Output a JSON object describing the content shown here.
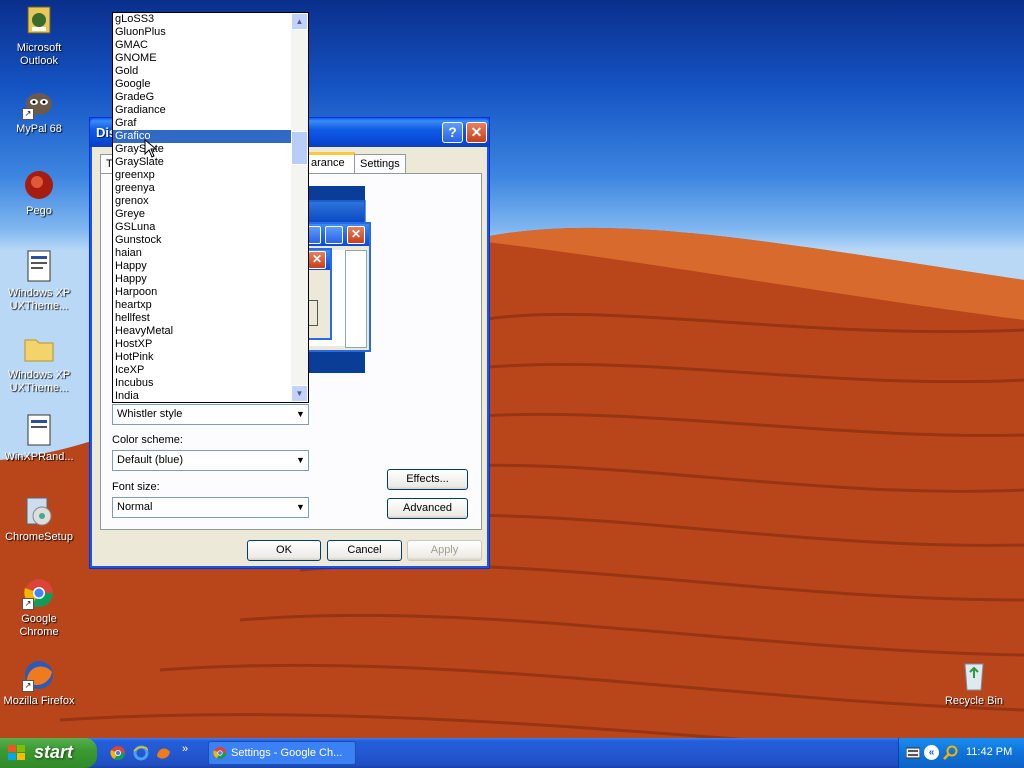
{
  "desktop": {
    "icons": [
      {
        "label": "Microsoft\nOutlook",
        "icon": "outlook-icon"
      },
      {
        "label": "MyPal 68",
        "icon": "mypal-icon"
      },
      {
        "label": "Pego",
        "icon": "pego-icon"
      },
      {
        "label": "Windows XP UXTheme...",
        "icon": "document-icon"
      },
      {
        "label": "Windows XP UXTheme...",
        "icon": "folder-icon"
      },
      {
        "label": "WinXPRand...",
        "icon": "document-icon"
      },
      {
        "label": "ChromeSetup",
        "icon": "installer-icon"
      },
      {
        "label": "Google Chrome",
        "icon": "chrome-icon"
      },
      {
        "label": "Mozilla Firefox",
        "icon": "firefox-icon"
      },
      {
        "label": "Recycle Bin",
        "icon": "recycle-bin-icon"
      }
    ]
  },
  "dialog": {
    "title": "Dis",
    "tabs": [
      "T",
      "arance",
      "Settings"
    ],
    "help_btn": "?",
    "close_btn": "✕",
    "windows_buttons_value": "Whistler style",
    "color_scheme_label": "Color scheme:",
    "color_scheme_value": "Default (blue)",
    "font_size_label": "Font size:",
    "font_size_value": "Normal",
    "effects_btn": "Effects...",
    "advanced_btn": "Advanced",
    "ok_btn": "OK",
    "cancel_btn": "Cancel",
    "apply_btn": "Apply"
  },
  "dropdown": {
    "selected": "Grafico",
    "items": [
      "gLoSS3",
      "GluonPlus",
      "GMAC",
      "GNOME",
      "Gold",
      "Google",
      "GradeG",
      "Gradiance",
      "Graf",
      "Grafico",
      "GraySlate",
      "GraySlate",
      "greenxp",
      "greenya",
      "grenox",
      "Greye",
      "GSLuna",
      "Gunstock",
      "haian",
      "Happy",
      "Happy",
      "Harpoon",
      "heartxp",
      "hellfest",
      "HeavyMetal",
      "HostXP",
      "HotPink",
      "IceXP",
      "Incubus",
      "India"
    ]
  },
  "taskbar": {
    "start_label": "start",
    "task_label": "Settings - Google Ch...",
    "clock": "11:42 PM",
    "quick_launch": [
      "chrome-icon",
      "ie-icon",
      "firefox-icon"
    ],
    "chevron": "»"
  }
}
